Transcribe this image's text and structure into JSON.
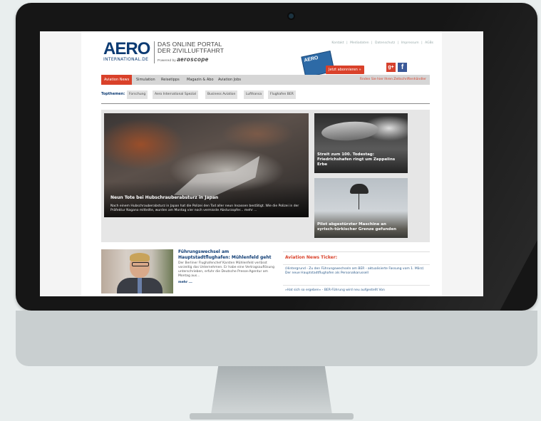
{
  "site": {
    "logo_main": "AERO",
    "logo_sub": "INTERNATIONAL.DE",
    "portal_line1": "DAS ONLINE PORTAL",
    "portal_line2": "DER ZIVILLUFTFAHRT",
    "powered_by": "Powered by",
    "powered_brand": "aeroscope"
  },
  "toplinks": [
    "Kontakt",
    "|",
    "Mediadaten",
    "|",
    "Datenschutz",
    "|",
    "Impressum",
    "|",
    "AGBs"
  ],
  "magazine": {
    "label": "AERO",
    "abo_button": "Jetzt abonnieren »"
  },
  "social": {
    "gplus": "g+",
    "facebook": "f"
  },
  "nav": {
    "items": [
      "Aviation News",
      "Simulation",
      "Reisetipps",
      "Magazin & Abo",
      "Aviation Jobs"
    ],
    "right": "Finden Sie hier Ihren Zeitschriftenhändler"
  },
  "topics": {
    "label": "Topthemen:",
    "items": [
      "Forschung",
      "Aero International Spezial",
      "Business Aviation",
      "Lufthansa",
      "Flughafen BER"
    ]
  },
  "hero": {
    "title": "Neun Tote bei Hubschrauberabsturz in Japan",
    "text": "Nach einem Hubschrauberabsturz in Japan hat die Polizei den Tod aller neun Insassen bestätigt. Wie die Polizei in der Präfektur Nagano mitteilte, wurden am Montag vier noch vermisste Absturzopfer... mehr ..."
  },
  "side_stories": [
    {
      "title": "Streit zum 100. Todestag: Friedrichshafen ringt um Zeppelins Erbe"
    },
    {
      "title": "Pilot abgestürzter Maschine an syrisch-türkischer Grenze gefunden"
    }
  ],
  "article": {
    "title": "Führungswechsel am Hauptstadtflughafen: Mühlenfeld geht",
    "text": "Der Berliner Flughafenchef Karsten Mühlenfeld verlässt vorzeitig das Unternehmen. Er habe eine Vertragsauflösung unterschrieben, erfuhr die Deutsche Presse-Agentur am Montag aus...",
    "more": "mehr ..."
  },
  "ticker": {
    "title": "Aviation News Ticker:",
    "items": [
      "(Hintergrund - Zu den Führungswechseln am BER - aktualisierte Fassung vom 1. März) Der neue Hauptstadtflughafen als Personalkarussell",
      "»Hat sich so ergeben« - BER-Führung wird neu aufgestellt Von"
    ]
  }
}
